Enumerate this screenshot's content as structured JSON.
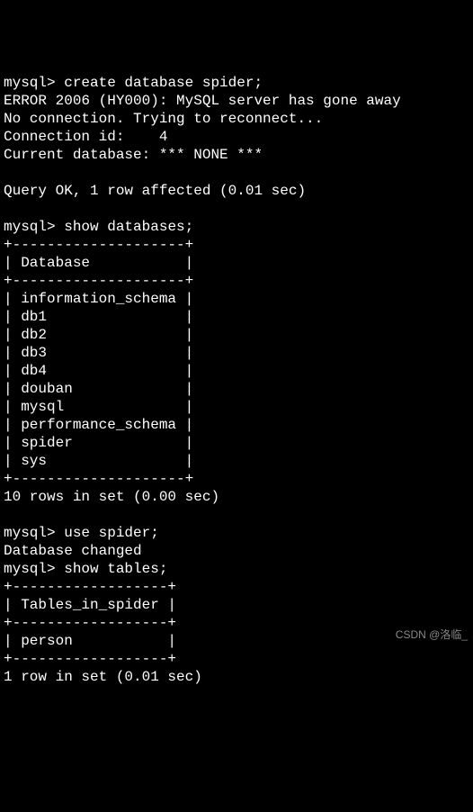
{
  "terminal": {
    "lines": [
      "mysql> create database spider;",
      "ERROR 2006 (HY000): MySQL server has gone away",
      "No connection. Trying to reconnect...",
      "Connection id:    4",
      "Current database: *** NONE ***",
      "",
      "Query OK, 1 row affected (0.01 sec)",
      "",
      "mysql> show databases;",
      "+--------------------+",
      "| Database           |",
      "+--------------------+",
      "| information_schema |",
      "| db1                |",
      "| db2                |",
      "| db3                |",
      "| db4                |",
      "| douban             |",
      "| mysql              |",
      "| performance_schema |",
      "| spider             |",
      "| sys                |",
      "+--------------------+",
      "10 rows in set (0.00 sec)",
      "",
      "mysql> use spider;",
      "Database changed",
      "mysql> show tables;",
      "+------------------+",
      "| Tables_in_spider |",
      "+------------------+",
      "| person           |",
      "+------------------+",
      "1 row in set (0.01 sec)"
    ]
  },
  "prompts": {
    "p1": "mysql>",
    "p2": "mysql>",
    "p3": "mysql>",
    "p4": "mysql>"
  },
  "commands": {
    "c1": "create database spider;",
    "c2": "show databases;",
    "c3": "use spider;",
    "c4": "show tables;"
  },
  "results": {
    "error_line": "ERROR 2006 (HY000): MySQL server has gone away",
    "reconnect_line": "No connection. Trying to reconnect...",
    "conn_id_label": "Connection id:    ",
    "conn_id_value": "4",
    "current_db_label": "Current database: ",
    "current_db_value": "*** NONE ***",
    "query_ok_1": "Query OK, 1 row affected (0.01 sec)",
    "db_table_border_top": "+--------------------+",
    "db_table_header": "| Database           |",
    "db_table_border_mid": "+--------------------+",
    "db_row_0": "| information_schema |",
    "db_row_1": "| db1                |",
    "db_row_2": "| db2                |",
    "db_row_3": "| db3                |",
    "db_row_4": "| db4                |",
    "db_row_5": "| douban             |",
    "db_row_6": "| mysql              |",
    "db_row_7": "| performance_schema |",
    "db_row_8": "| spider             |",
    "db_row_9": "| sys                |",
    "db_table_border_bot": "+--------------------+",
    "db_count": "10 rows in set (0.00 sec)",
    "db_changed": "Database changed",
    "tbl_border_top": "+------------------+",
    "tbl_header": "| Tables_in_spider |",
    "tbl_border_mid": "+------------------+",
    "tbl_row_0": "| person           |",
    "tbl_border_bot": "+------------------+",
    "tbl_count": "1 row in set (0.01 sec)"
  },
  "watermark": "CSDN @洛临_"
}
